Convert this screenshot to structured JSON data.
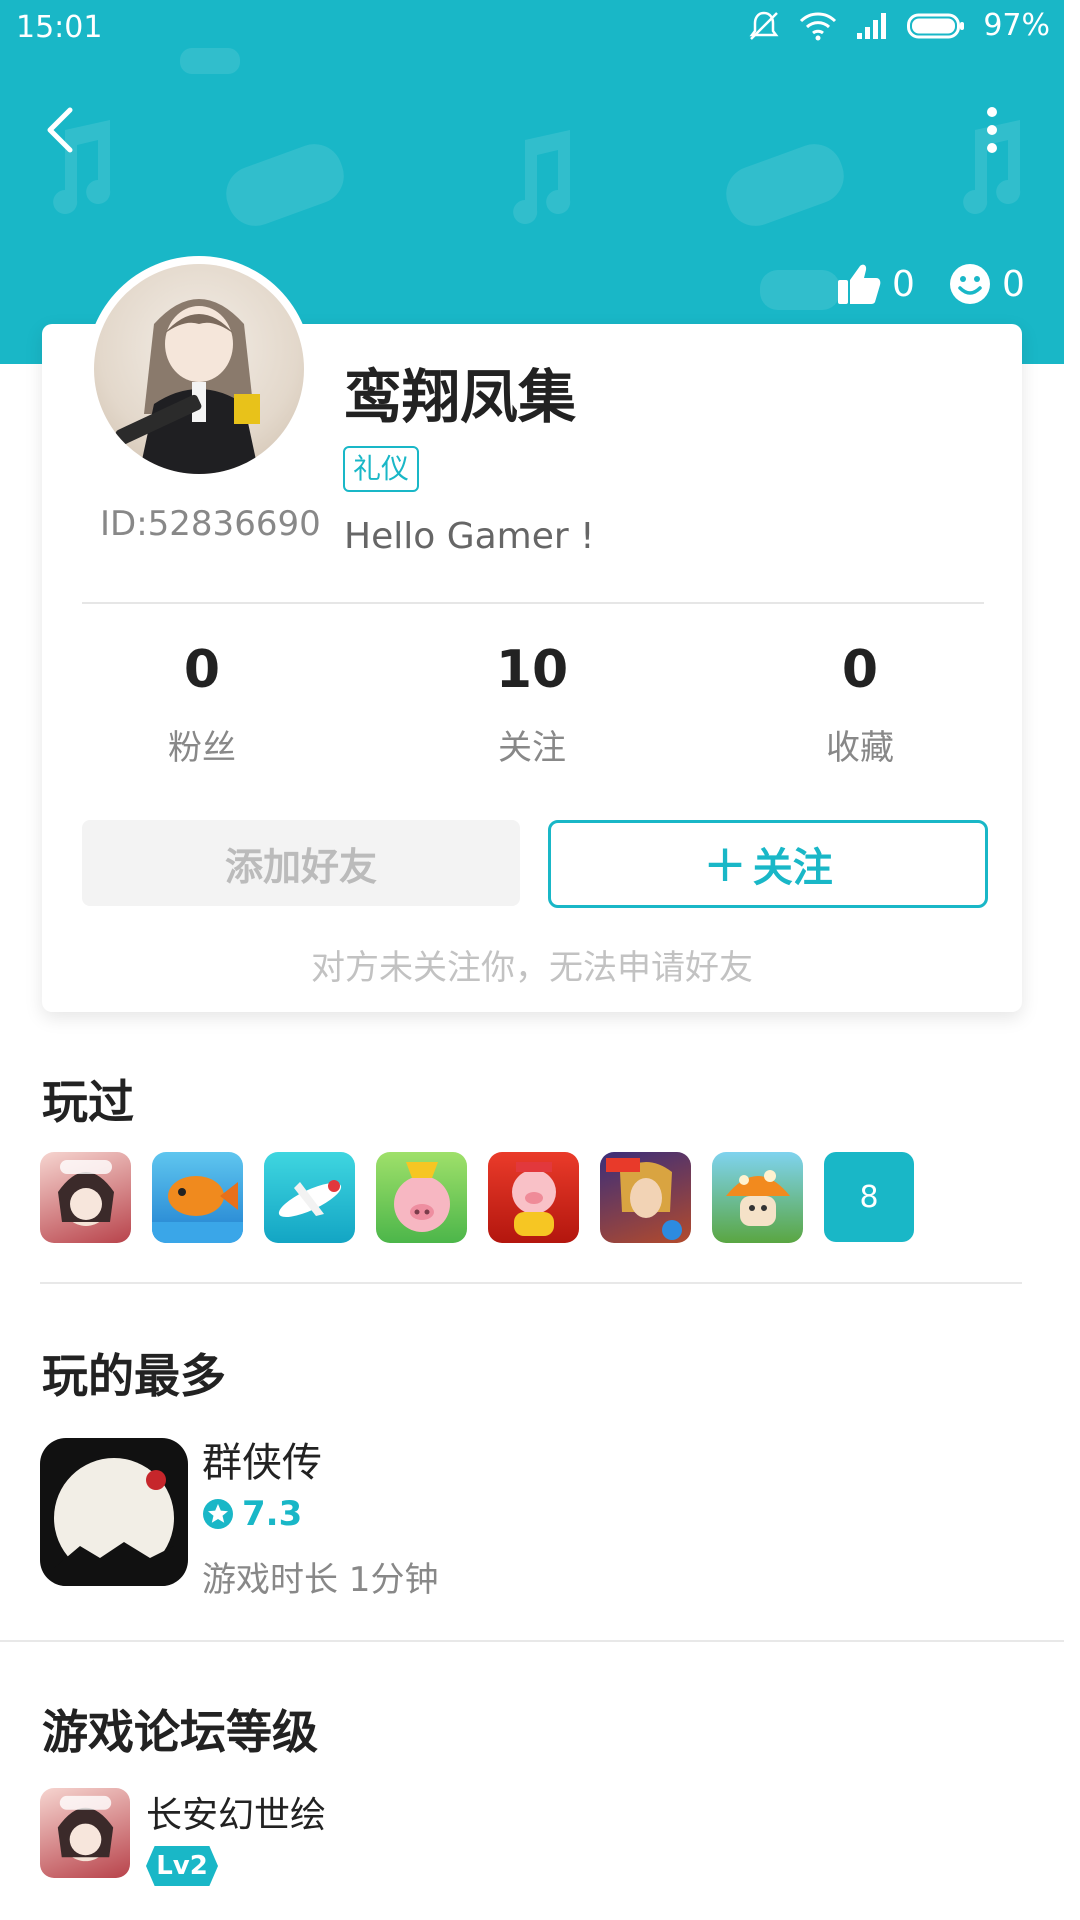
{
  "status_bar": {
    "time": "15:01",
    "battery": "97%"
  },
  "header": {
    "likes_count": "0",
    "smile_count": "0"
  },
  "profile": {
    "name": "鸾翔凤集",
    "tag": "礼仪",
    "user_id": "ID:52836690",
    "bio": "Hello Gamer !"
  },
  "stats": [
    {
      "value": "0",
      "label": "粉丝"
    },
    {
      "value": "10",
      "label": "关注"
    },
    {
      "value": "0",
      "label": "收藏"
    }
  ],
  "actions": {
    "add_friend": "添加好友",
    "follow": "关注",
    "follow_prefix": "+",
    "hint": "对方未关注你，无法申请好友"
  },
  "played": {
    "title": "玩过",
    "more_count": "8",
    "games": [
      "game-icon-1",
      "game-icon-2",
      "game-icon-3",
      "game-icon-4",
      "game-icon-5",
      "game-icon-6",
      "game-icon-7"
    ]
  },
  "most_played": {
    "title": "玩的最多",
    "game_name": "群侠传",
    "rating": "7.3",
    "play_time": "游戏时长 1分钟",
    "icon_text": "群侠传"
  },
  "forum": {
    "title": "游戏论坛等级",
    "game_name": "长安幻世绘",
    "level": "Lv2"
  },
  "colors": {
    "accent": "#19b7c7"
  }
}
